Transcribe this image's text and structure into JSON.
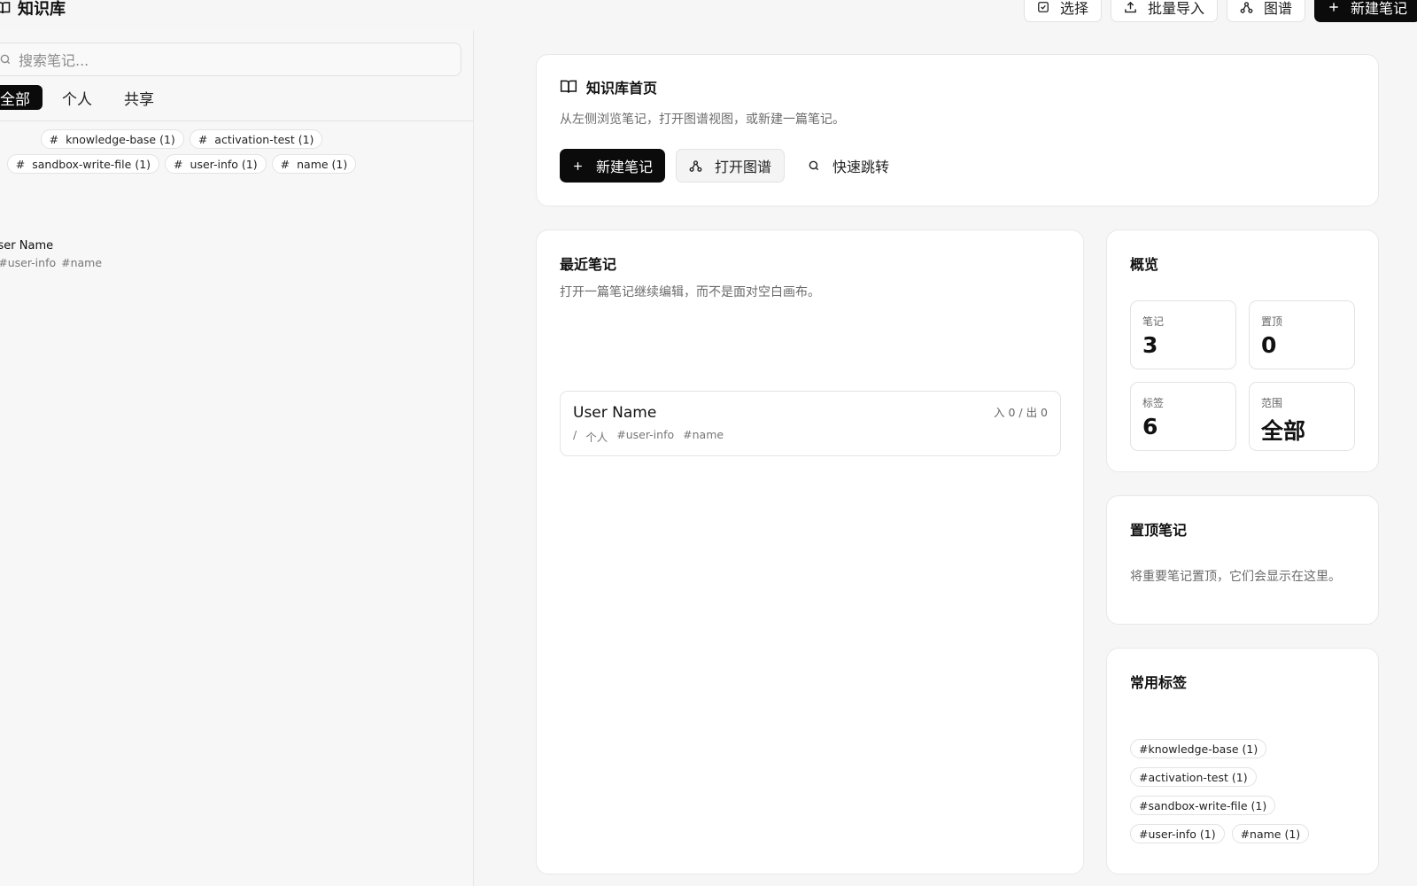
{
  "app": {
    "title": "知识库"
  },
  "toolbar": {
    "select_label": "选择",
    "import_label": "批量导入",
    "graph_label": "图谱",
    "new_note_label": "新建笔记"
  },
  "sidebar": {
    "search_placeholder": "搜索笔记...",
    "scope_tabs": [
      "全部",
      "个人",
      "共享"
    ],
    "tags": [
      "knowledge-base (1)",
      "activation-test (1)",
      "sandbox-write-file (1)",
      "user-info (1)",
      "name (1)"
    ],
    "note": {
      "title": "User Name",
      "path": "/",
      "tags": [
        "#user-info",
        "#name"
      ]
    }
  },
  "hero": {
    "title": "知识库首页",
    "description": "从左侧浏览笔记，打开图谱视图，或新建一篇笔记。",
    "new_note_label": "新建笔记",
    "open_graph_label": "打开图谱",
    "quick_jump_label": "快速跳转"
  },
  "recent": {
    "title": "最近笔记",
    "description": "打开一篇笔记继续编辑，而不是面对空白画布。",
    "item": {
      "title": "User Name",
      "links": "入 0 / 出 0",
      "path": "/",
      "scope": "个人",
      "tags": [
        "#user-info",
        "#name"
      ]
    }
  },
  "overview": {
    "title": "概览",
    "stats": [
      {
        "label": "笔记",
        "value": "3"
      },
      {
        "label": "置顶",
        "value": "0"
      },
      {
        "label": "标签",
        "value": "6"
      },
      {
        "label": "范围",
        "value": "全部"
      }
    ]
  },
  "pinned": {
    "title": "置顶笔记",
    "empty_text": "将重要笔记置顶，它们会显示在这里。"
  },
  "common_tags": {
    "title": "常用标签",
    "tags": [
      "#knowledge-base (1)",
      "#activation-test (1)",
      "#sandbox-write-file (1)",
      "#user-info (1)",
      "#name (1)"
    ]
  },
  "icons": {
    "app": "book-icon",
    "select": "checkbox-icon",
    "import": "upload-icon",
    "graph": "graph-icon",
    "new": "plus-icon",
    "search": "search-icon",
    "tag": "hash-icon"
  },
  "colors": {
    "primary": "#0b0b0b",
    "background": "#f6f6f6",
    "card": "#ffffff",
    "border": "#e4e4e4",
    "muted": "#6b6b6b"
  }
}
